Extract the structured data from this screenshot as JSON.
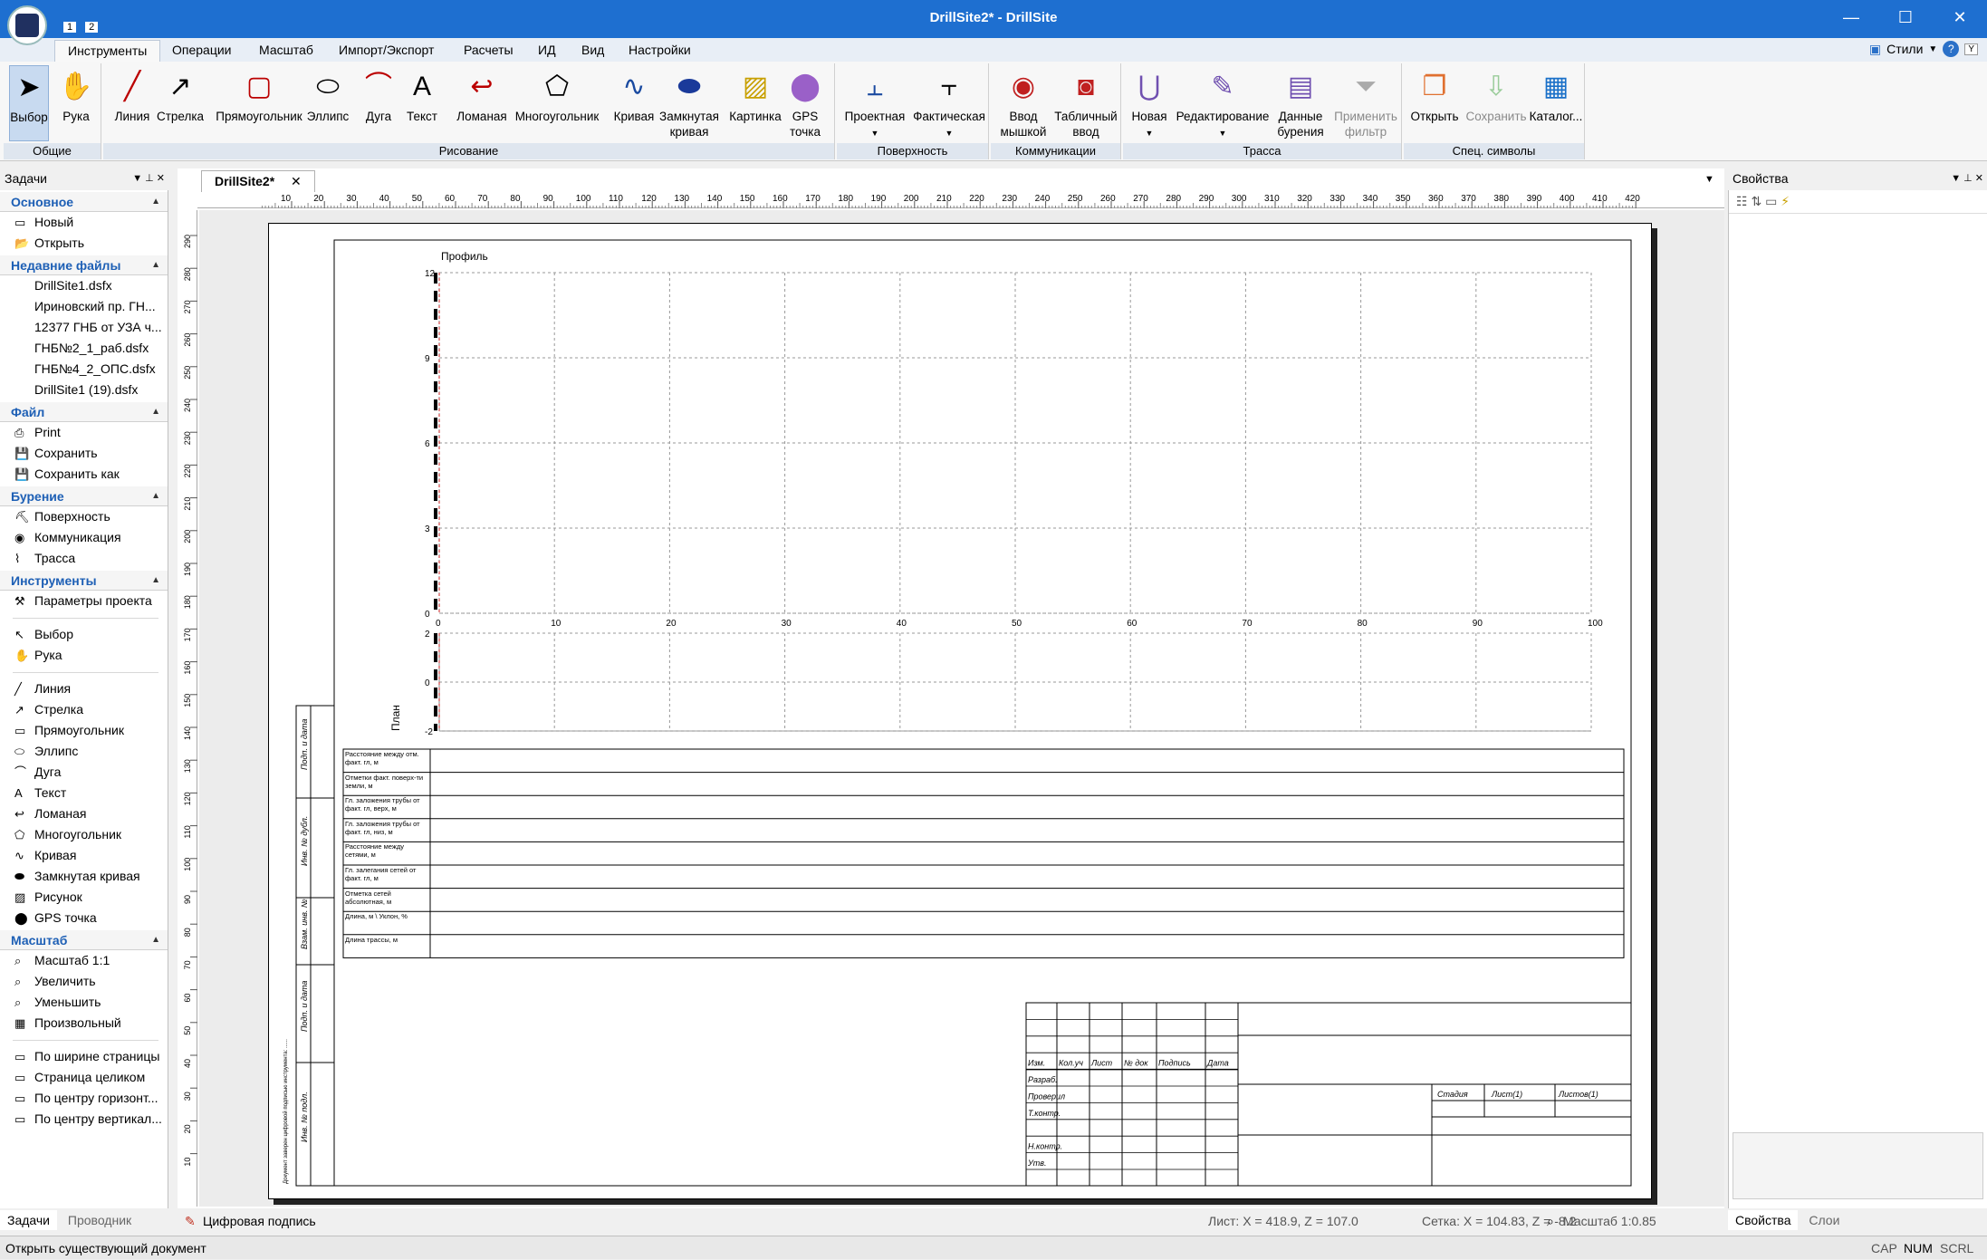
{
  "window": {
    "title": "DrillSite2* - DrillSite",
    "qat_1": "1",
    "qat_2": "2"
  },
  "ribbon_tabs": [
    "Инструменты",
    "Операции",
    "Масштаб",
    "Импорт/Экспорт",
    "Расчеты",
    "ИД",
    "Вид",
    "Настройки"
  ],
  "styles_label": "Стили",
  "styles_hint": "Y",
  "groups": {
    "common": {
      "label": "Общие",
      "select": "Выбор",
      "hand": "Рука"
    },
    "drawing": {
      "label": "Рисование",
      "line": "Линия",
      "arrow": "Стрелка",
      "rect": "Прямоугольник",
      "ellipse": "Эллипс",
      "arc": "Дуга",
      "text": "Текст",
      "polyline": "Ломаная",
      "polygon": "Многоугольник",
      "curve": "Кривая",
      "closed1": "Замкнутая",
      "closed2": "кривая",
      "picture": "Картинка",
      "gps1": "GPS",
      "gps2": "точка"
    },
    "surface": {
      "label": "Поверхность",
      "design": "Проектная",
      "actual": "Фактическая"
    },
    "comms": {
      "label": "Коммуникации",
      "mouse1": "Ввод",
      "mouse2": "мышкой",
      "table1": "Табличный",
      "table2": "ввод"
    },
    "route": {
      "label": "Трасса",
      "new": "Новая",
      "edit": "Редактирование",
      "drill1": "Данные",
      "drill2": "бурения",
      "filter1": "Применить",
      "filter2": "фильтр"
    },
    "symbols": {
      "label": "Спец. символы",
      "open": "Открыть",
      "save": "Сохранить",
      "catalog": "Каталог..."
    }
  },
  "tasks": {
    "header": "Задачи",
    "sections": {
      "basic": {
        "title": "Основное",
        "items": [
          "Новый",
          "Открыть"
        ]
      },
      "recent": {
        "title": "Недавние файлы",
        "items": [
          "DrillSite1.dsfx",
          "Ириновский пр. ГН...",
          "12377 ГНБ от УЗА ч...",
          "ГНБ№2_1_раб.dsfx",
          "ГНБ№4_2_ОПС.dsfx",
          "DrillSite1 (19).dsfx"
        ]
      },
      "file": {
        "title": "Файл",
        "items": [
          "Print",
          "Сохранить",
          "Сохранить как"
        ]
      },
      "drilling": {
        "title": "Бурение",
        "items": [
          "Поверхность",
          "Коммуникация",
          "Трасса"
        ]
      },
      "tools": {
        "title": "Инструменты",
        "items": [
          "Параметры проекта",
          "Выбор",
          "Рука",
          "Линия",
          "Стрелка",
          "Прямоугольник",
          "Эллипс",
          "Дуга",
          "Текст",
          "Ломаная",
          "Многоугольник",
          "Кривая",
          "Замкнутая кривая",
          "Рисунок",
          "GPS точка"
        ]
      },
      "scale": {
        "title": "Масштаб",
        "items": [
          "Масштаб 1:1",
          "Увеличить",
          "Уменьшить",
          "Произвольный",
          "По ширине страницы",
          "Страница целиком",
          "По центру горизонт...",
          "По центру вертикал..."
        ]
      }
    },
    "bottom_tabs": [
      "Задачи",
      "Проводник"
    ]
  },
  "document": {
    "tab": "DrillSite2*",
    "ruler_h": [
      "10",
      "20",
      "30",
      "40",
      "50",
      "60",
      "70",
      "80",
      "90",
      "100",
      "110",
      "120",
      "130",
      "140",
      "150",
      "160",
      "170",
      "180",
      "190",
      "200",
      "210",
      "220",
      "230",
      "240",
      "250",
      "260",
      "270",
      "280",
      "290",
      "300",
      "310",
      "320",
      "330",
      "340",
      "350",
      "360",
      "370",
      "380",
      "390",
      "400",
      "410",
      "420"
    ],
    "ruler_v": [
      "290",
      "280",
      "270",
      "260",
      "250",
      "240",
      "230",
      "220",
      "210",
      "200",
      "190",
      "180",
      "170",
      "160",
      "150",
      "140",
      "130",
      "120",
      "110",
      "100",
      "90",
      "80",
      "70",
      "60",
      "50",
      "40",
      "30",
      "20",
      "10"
    ],
    "profile_title": "Профиль",
    "plan_label": "План",
    "rows": [
      "Расстояние между отм. факт. гл, м",
      "Отметки факт. поверх-ти земли, м",
      "Гл. заложения трубы от факт. гл, верх, м",
      "Гл. заложения трубы от факт. гл, низ, м",
      "Расстояние между сетями, м",
      "Гл. залегания сетей от факт. гл, м",
      "Отметка сетей абсолютная, м",
      "Длина, м \\ Уклон, %",
      "Длина трассы, м"
    ],
    "side_stamp": [
      "Подп. и дата",
      "Инв. № дубл.",
      "Взам. инв. №",
      "Подп. и дата",
      "Инв. № подл."
    ],
    "side_text": "Документ заверен цифровой подписью инструмента: ......",
    "title_block": {
      "header": [
        "Изм.",
        "Кол.уч",
        "Лист",
        "№ док",
        "Подпись",
        "Дата"
      ],
      "roles": [
        "Разраб.",
        "Проверил",
        "Т.контр.",
        "",
        "Н.контр.",
        "Утв."
      ],
      "stage": [
        "Стадия",
        "Лист(1)",
        "Листов(1)"
      ]
    }
  },
  "chart_data": [
    {
      "type": "line",
      "title": "Профиль",
      "xlabel": "",
      "ylabel": "",
      "x_ticks": [
        0,
        10,
        20,
        30,
        40,
        50,
        60,
        70,
        80,
        90,
        100
      ],
      "y_ticks": [
        0,
        3,
        6,
        9,
        12
      ],
      "xlim": [
        0,
        100
      ],
      "ylim": [
        0,
        12
      ],
      "grid": true,
      "series": []
    },
    {
      "type": "line",
      "title": "",
      "xlabel": "",
      "ylabel": "План",
      "y_ticks": [
        -2,
        0,
        2
      ],
      "xlim": [
        0,
        100
      ],
      "ylim": [
        -2,
        2
      ],
      "grid": true,
      "series": []
    }
  ],
  "properties": {
    "header": "Свойства",
    "bottom_tabs": [
      "Свойства",
      "Слои"
    ]
  },
  "status": {
    "hint": "Открыть существующий документ",
    "signature": "Цифровая подпись",
    "sheet": "Лист: X = 418.9, Z = 107.0",
    "grid": "Сетка: X = 104.83, Z = -8.2",
    "scale": "Масштаб 1:0.85",
    "cap": "CAP",
    "num": "NUM",
    "scrl": "SCRL"
  },
  "colors": {
    "titlebar": "#1e6fd0",
    "section": "#1d5fb5",
    "axis_red": "#d02020"
  }
}
